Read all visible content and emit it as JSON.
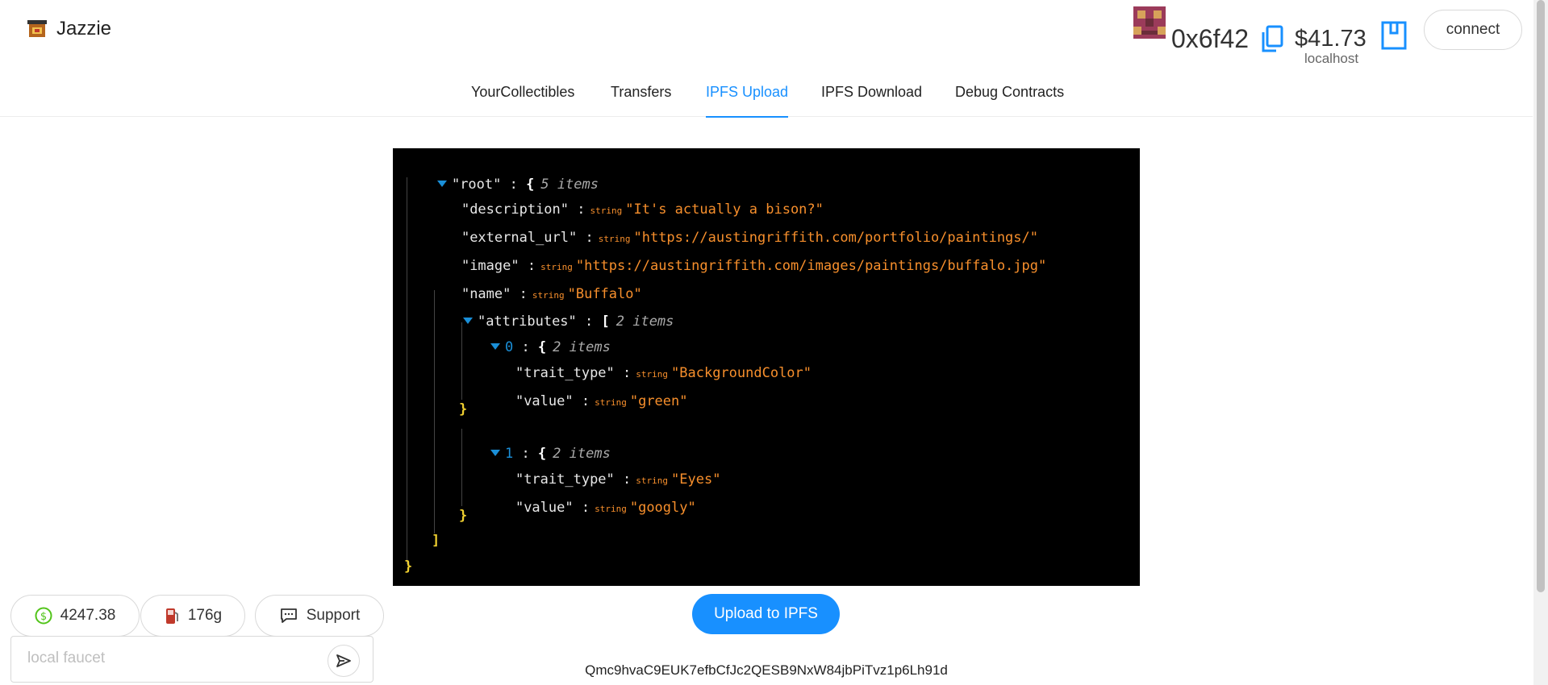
{
  "header": {
    "app_name": "Jazzie",
    "address": "0x6f42",
    "balance": "$41.73",
    "network": "localhost",
    "connect_label": "connect"
  },
  "nav": {
    "tabs": [
      {
        "label": "YourCollectibles"
      },
      {
        "label": "Transfers"
      },
      {
        "label": "IPFS Upload"
      },
      {
        "label": "IPFS Download"
      },
      {
        "label": "Debug Contracts"
      }
    ],
    "active": "IPFS Upload"
  },
  "json_view": {
    "root_key": "\"root\"",
    "root_count": "5 items",
    "type_label": "string",
    "description_key": "\"description\"",
    "description_value": "\"It's actually a bison?\"",
    "external_url_key": "\"external_url\"",
    "external_url_value": "\"https://austingriffith.com/portfolio/paintings/\"",
    "image_key": "\"image\"",
    "image_value": "\"https://austingriffith.com/images/paintings/buffalo.jpg\"",
    "name_key": "\"name\"",
    "name_value": "\"Buffalo\"",
    "attributes_key": "\"attributes\"",
    "attributes_count": "2 items",
    "attr0_index": "0",
    "attr0_count": "2 items",
    "attr0_trait_key": "\"trait_type\"",
    "attr0_trait_value": "\"BackgroundColor\"",
    "attr0_value_key": "\"value\"",
    "attr0_value_value": "\"green\"",
    "attr1_index": "1",
    "attr1_count": "2 items",
    "attr1_trait_key": "\"trait_type\"",
    "attr1_trait_value": "\"Eyes\"",
    "attr1_value_key": "\"value\"",
    "attr1_value_value": "\"googly\""
  },
  "upload_label": "Upload to IPFS",
  "ipfs_hash": "Qmc9hvaC9EUK7efbCfJc2QESB9NxW84jbPiTvz1p6Lh91d",
  "footer": {
    "eth_price": "4247.38",
    "gas": "176g",
    "support_label": "Support",
    "faucet_placeholder": "local faucet"
  },
  "colors": {
    "accent": "#1890ff",
    "json_string": "#f78f2c",
    "json_index": "#1a8fd8"
  },
  "icons": [
    "app-logo-icon",
    "blockie-avatar",
    "copy-icon",
    "wallet-icon",
    "dollar-icon",
    "gas-pump-icon",
    "chat-icon",
    "send-icon",
    "caret-down-icon"
  ]
}
